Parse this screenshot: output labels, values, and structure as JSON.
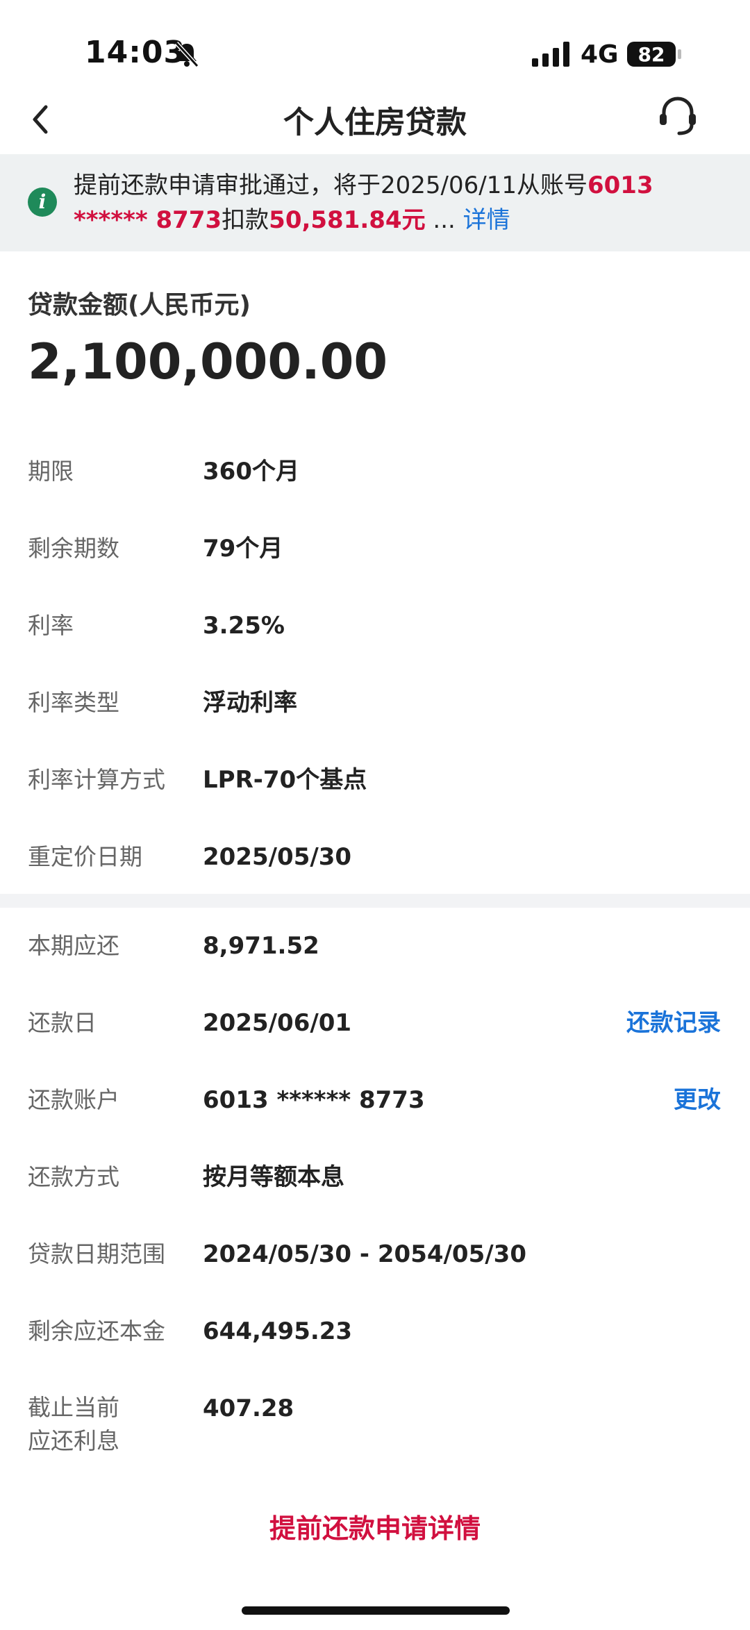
{
  "status_bar": {
    "time": "14:03",
    "network": "4G",
    "battery": "82"
  },
  "nav": {
    "title": "个人住房贷款"
  },
  "notice": {
    "icon": "i",
    "text_prefix": "提前还款申请审批通过，将于2025/06/11从账号",
    "account": "6013 ****** 8773",
    "text_mid": "扣款",
    "amount": "50,581.84元",
    "ellipsis": " ... ",
    "detail_link": "详情"
  },
  "loan": {
    "amount_label": "贷款金额(人民币元)",
    "amount_value": "2,100,000.00"
  },
  "details": [
    {
      "label": "期限",
      "value": "360个月"
    },
    {
      "label": "剩余期数",
      "value": "79个月"
    },
    {
      "label": "利率",
      "value": "3.25%"
    },
    {
      "label": "利率类型",
      "value": "浮动利率"
    },
    {
      "label": "利率计算方式",
      "value": "LPR-70个基点"
    },
    {
      "label": "重定价日期",
      "value": "2025/05/30"
    }
  ],
  "repayment": [
    {
      "label": "本期应还",
      "value": "8,971.52"
    },
    {
      "label": "还款日",
      "value": "2025/06/01",
      "action": "还款记录"
    },
    {
      "label": "还款账户",
      "value": "6013 ****** 8773",
      "action": "更改"
    },
    {
      "label": "还款方式",
      "value": "按月等额本息"
    },
    {
      "label": "贷款日期范围",
      "value": "2024/05/30 - 2054/05/30"
    },
    {
      "label": "剩余应还本金",
      "value": "644,495.23"
    },
    {
      "label_line1": "截止当前",
      "label_line2": "应还利息",
      "value": "407.28"
    }
  ],
  "bottom_link": "提前还款申请详情"
}
